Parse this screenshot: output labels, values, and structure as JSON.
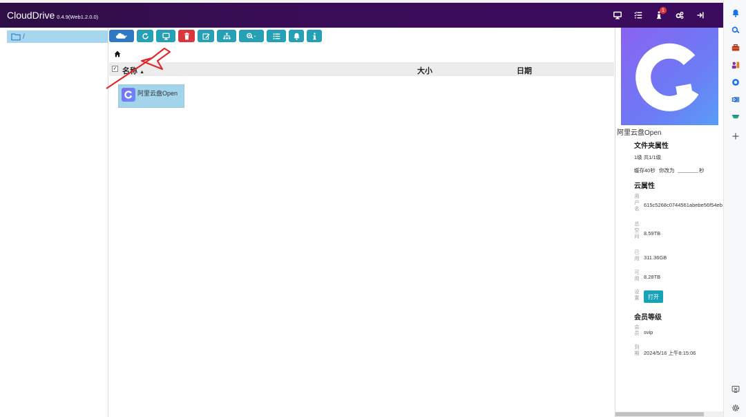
{
  "app": {
    "title": "CloudDrive",
    "version": "0.4.9(Web1.2.0.0)"
  },
  "navbar": {
    "icons": [
      "monitor-icon",
      "task-list-icon",
      "info-icon",
      "gears-icon",
      "logout-icon"
    ],
    "badge_count": "1"
  },
  "tree": {
    "root_label": "/"
  },
  "toolbar": {
    "buttons": [
      "cloud-menu",
      "refresh",
      "mount",
      "delete",
      "rename",
      "sitemap",
      "zoom-menu",
      "list",
      "notify",
      "info"
    ]
  },
  "table": {
    "columns": {
      "name": "名称",
      "size": "大小",
      "date": "日期"
    },
    "sort_indicator": "▲"
  },
  "files": [
    {
      "name": "阿里云盘Open"
    }
  ],
  "details": {
    "preview_name": "阿里云盘Open",
    "folder_props_title": "文件夹属性",
    "folder_props_line1": "1级  共1/1级",
    "folder_props_line2_a": "缓存40秒",
    "folder_props_line2_b": "你改为",
    "folder_props_line2_c": "秒",
    "cloud_props_title": "云属性",
    "user_label": "用户名",
    "user_value": "615c5268c0744561abebe56f54eb",
    "total_label": "总空间",
    "total_value": "8.59TB",
    "used_label": "已用",
    "used_value": "311.36GB",
    "avail_label": "可用",
    "avail_value": "8.28TB",
    "setting_label": "设置",
    "open_button": "打开",
    "member_title": "会员等级",
    "member_label": "会员",
    "member_value": "svip",
    "expire_label": "到期",
    "expire_value": "2024/5/16 上午8:15:06"
  },
  "colors": {
    "navbar": "#3a0d58",
    "btn_blue": "#2f78c4",
    "btn_teal": "#26a0b4",
    "btn_red": "#d9363e",
    "selection": "#a2d4ec",
    "arrow": "#e02a2a"
  }
}
